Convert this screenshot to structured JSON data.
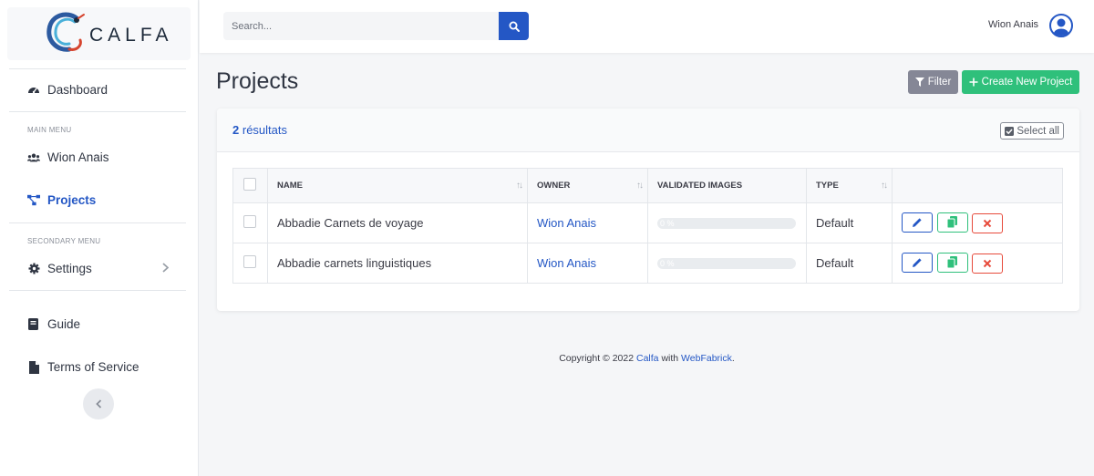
{
  "brand": {
    "name": "CALFA"
  },
  "sidebar": {
    "dashboard": "Dashboard",
    "main_menu_heading": "MAIN MENU",
    "user_item": "Wion Anais",
    "projects_item": "Projects",
    "secondary_menu_heading": "SECONDARY MENU",
    "settings_item": "Settings",
    "guide_item": "Guide",
    "terms_item": "Terms of Service"
  },
  "topbar": {
    "search_placeholder": "Search...",
    "user_name": "Wion Anais"
  },
  "main": {
    "title": "Projects",
    "filter_label": "Filter",
    "create_label": "Create New Project",
    "results_count": "2",
    "results_label": "résultats",
    "select_all_label": "Select all"
  },
  "table": {
    "columns": [
      "NAME",
      "OWNER",
      "VALIDATED IMAGES",
      "TYPE"
    ],
    "rows": [
      {
        "name": "Abbadie Carnets de voyage",
        "owner": "Wion Anais",
        "validated_pct": 0,
        "validated_label": "0 %",
        "type": "Default"
      },
      {
        "name": "Abbadie carnets linguistiques",
        "owner": "Wion Anais",
        "validated_pct": 0,
        "validated_label": "0 %",
        "type": "Default"
      }
    ]
  },
  "footer": {
    "prefix": "Copyright © 2022",
    "calfa_link": "Calfa",
    "with": "with",
    "webfabrick_link": "WebFabrick",
    "suffix": "."
  },
  "colors": {
    "primary": "#2457c5",
    "success": "#2fc07b",
    "danger": "#e74a3b",
    "secondary": "#858796"
  }
}
